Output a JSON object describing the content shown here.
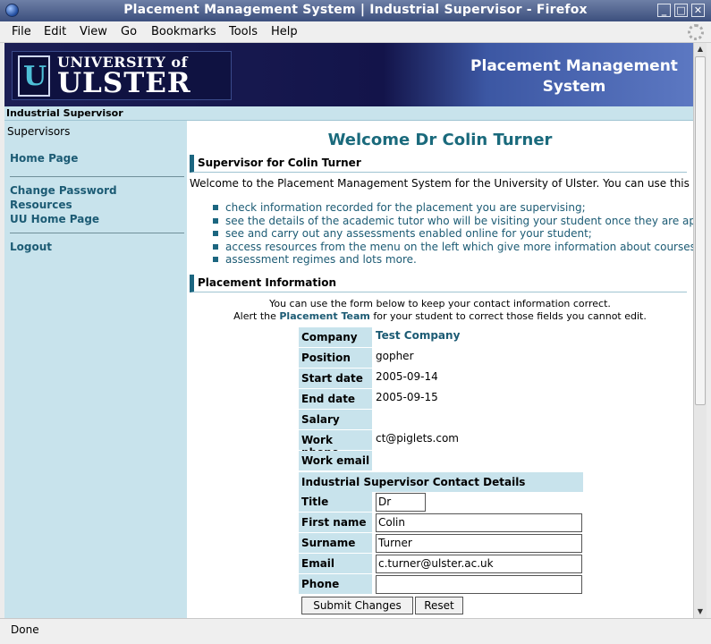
{
  "window": {
    "title": "Placement Management System | Industrial Supervisor - Firefox",
    "controls": [
      "_",
      "□",
      "✕"
    ]
  },
  "menubar": {
    "items": [
      "File",
      "Edit",
      "View",
      "Go",
      "Bookmarks",
      "Tools",
      "Help"
    ]
  },
  "banner": {
    "logo_line1": "UNIVERSITY of",
    "logo_line2": "ULSTER",
    "logo_mark": "U",
    "system_title": "Placement Management System"
  },
  "rolebar": {
    "label": "Industrial Supervisor"
  },
  "sidebar": {
    "heading": "Supervisors",
    "links": [
      "Home Page",
      "Change Password",
      "Resources",
      "UU Home Page",
      "Logout"
    ]
  },
  "main": {
    "welcome": "Welcome Dr Colin Turner",
    "section1": "Supervisor for Colin Turner",
    "intro": "Welcome to the Placement Management System for the University of Ulster. You can use this system",
    "bullets": [
      "check information recorded for the placement you are supervising;",
      "see the details of the academic tutor who will be visiting your student once they are appointed;",
      "see and carry out any assessments enabled online for your student;",
      "access resources from the menu on the left which give more information about courses,",
      "assessment regimes and lots more."
    ],
    "section2": "Placement Information",
    "note1": "You can use the form below to keep your contact information correct.",
    "note2_prefix": "Alert the ",
    "note2_link": "Placement Team",
    "note2_suffix": " for your student to correct those fields you cannot edit."
  },
  "form": {
    "fields": [
      {
        "label": "Company",
        "value": "Test Company"
      },
      {
        "label": "Position",
        "value": "gopher"
      },
      {
        "label": "Start date",
        "value": "2005-09-14"
      },
      {
        "label": "End date",
        "value": "2005-09-15"
      },
      {
        "label": "Salary",
        "value": ""
      },
      {
        "label": "Work phone",
        "value": "ct@piglets.com"
      },
      {
        "label": "Work email",
        "value": ""
      }
    ],
    "contact_heading": "Industrial Supervisor Contact Details",
    "contact": [
      {
        "label": "Title",
        "value": "Dr"
      },
      {
        "label": "First name",
        "value": "Colin"
      },
      {
        "label": "Surname",
        "value": "Turner"
      },
      {
        "label": "Email",
        "value": "c.turner@ulster.ac.uk"
      },
      {
        "label": "Phone",
        "value": ""
      }
    ],
    "submit_label": "Submit Changes",
    "reset_label": "Reset"
  },
  "status": {
    "text": "Done"
  }
}
